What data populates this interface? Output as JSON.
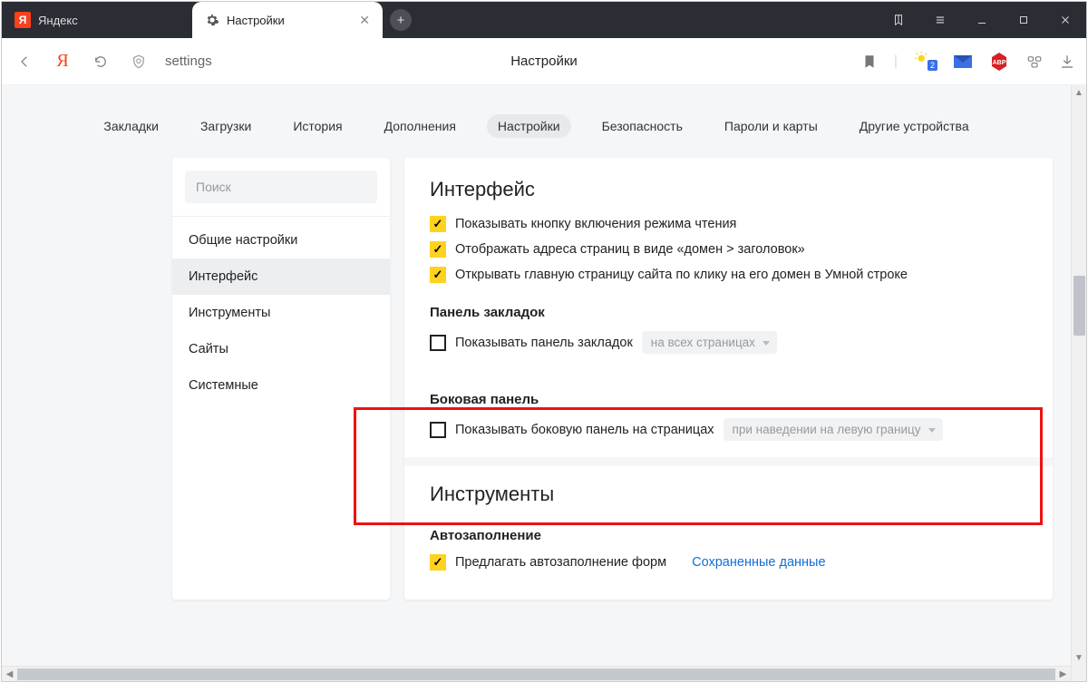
{
  "tabs": {
    "inactive": "Яндекс",
    "active": "Настройки"
  },
  "address": {
    "url": "settings",
    "title": "Настройки"
  },
  "topnav": {
    "items": [
      "Закладки",
      "Загрузки",
      "История",
      "Дополнения",
      "Настройки",
      "Безопасность",
      "Пароли и карты",
      "Другие устройства"
    ],
    "active_index": 4
  },
  "sidebar": {
    "search_placeholder": "Поиск",
    "items": [
      "Общие настройки",
      "Интерфейс",
      "Инструменты",
      "Сайты",
      "Системные"
    ],
    "active_index": 1
  },
  "sections": {
    "interface": {
      "title": "Интерфейс",
      "opts": [
        "Показывать кнопку включения режима чтения",
        "Отображать адреса страниц в виде «домен > заголовок»",
        "Открывать главную страницу сайта по клику на его домен в Умной строке"
      ],
      "bookmarks_bar": {
        "heading": "Панель закладок",
        "label": "Показывать панель закладок",
        "dropdown": "на всех страницах"
      },
      "side_panel": {
        "heading": "Боковая панель",
        "label": "Показывать боковую панель на страницах",
        "dropdown": "при наведении на левую границу"
      }
    },
    "tools": {
      "title": "Инструменты",
      "autofill": {
        "heading": "Автозаполнение",
        "label": "Предлагать автозаполнение форм",
        "link": "Сохраненные данные"
      }
    }
  },
  "weather_badge": "2"
}
